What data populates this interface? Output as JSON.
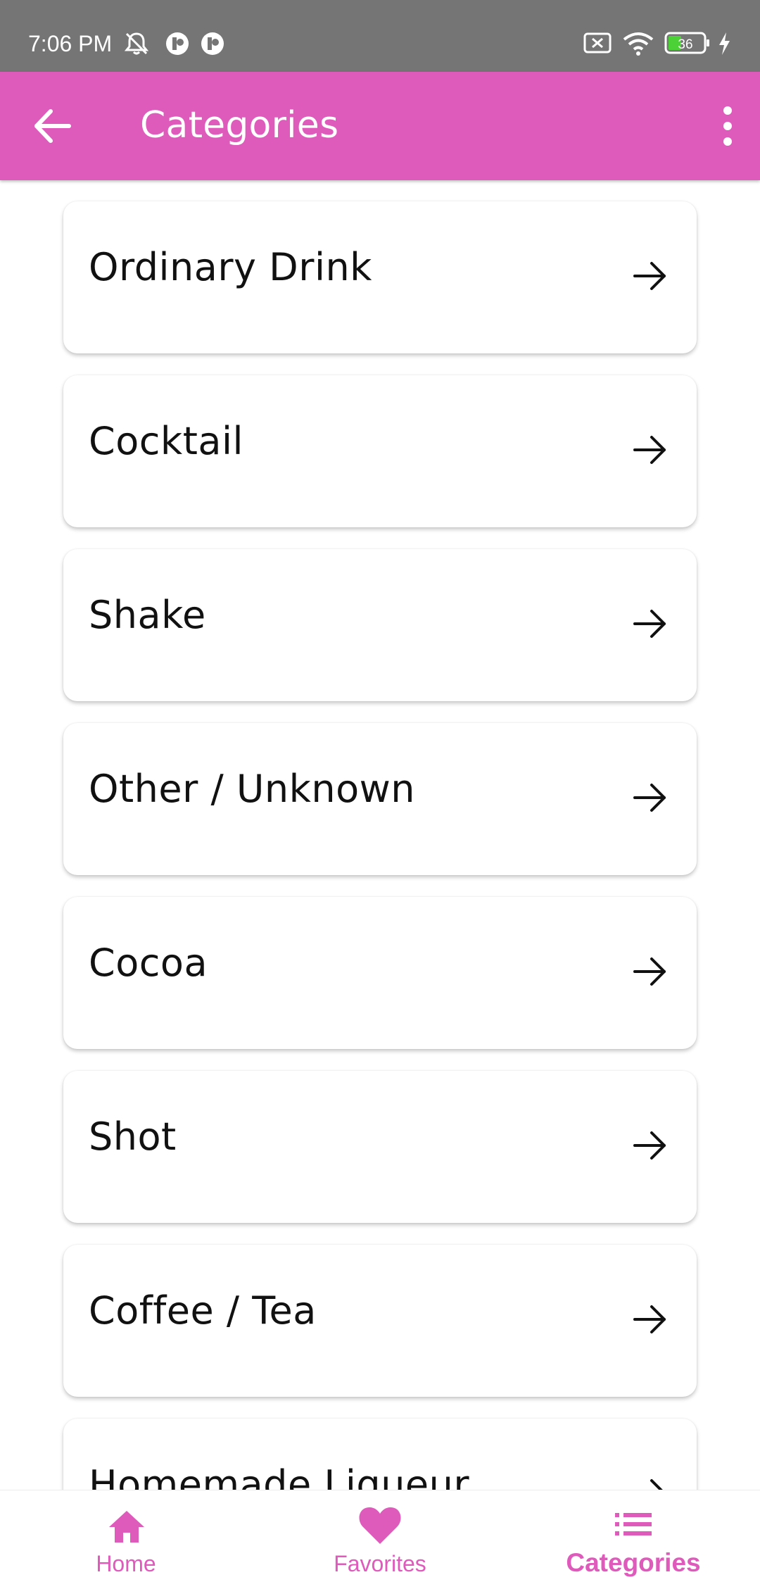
{
  "status_bar": {
    "time": "7:06 PM",
    "battery_level": "36",
    "icons": [
      "muted-bell-icon",
      "app-notification-icon",
      "app-notification-icon",
      "screen-record-icon",
      "wifi-icon",
      "battery-icon",
      "charging-icon"
    ]
  },
  "app_bar": {
    "title": "Categories",
    "back_icon": "arrow-left-icon",
    "menu_icon": "more-vert-icon",
    "color": "#de5bbb"
  },
  "categories": [
    {
      "label": "Ordinary Drink",
      "icon": "arrow-right-icon"
    },
    {
      "label": "Cocktail",
      "icon": "arrow-right-icon"
    },
    {
      "label": "Shake",
      "icon": "arrow-right-icon"
    },
    {
      "label": "Other / Unknown",
      "icon": "arrow-right-icon"
    },
    {
      "label": "Cocoa",
      "icon": "arrow-right-icon"
    },
    {
      "label": "Shot",
      "icon": "arrow-right-icon"
    },
    {
      "label": "Coffee / Tea",
      "icon": "arrow-right-icon"
    },
    {
      "label": "Homemade Liqueur",
      "icon": "arrow-right-icon"
    }
  ],
  "bottom_nav": {
    "items": [
      {
        "label": "Home",
        "icon": "home-icon",
        "active": false
      },
      {
        "label": "Favorites",
        "icon": "heart-icon",
        "active": false
      },
      {
        "label": "Categories",
        "icon": "list-icon",
        "active": true
      }
    ],
    "accent": "#de5bbb"
  }
}
